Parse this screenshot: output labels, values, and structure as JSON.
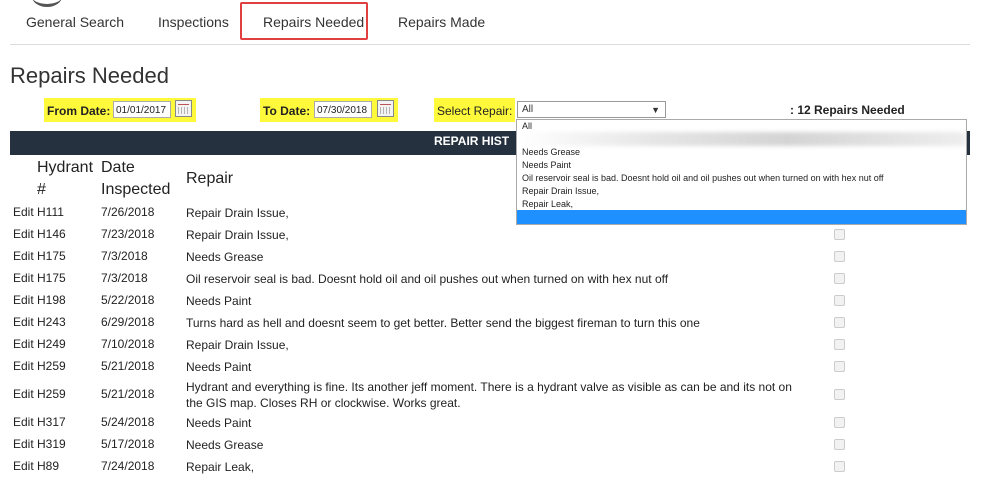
{
  "nav": {
    "tabs": [
      {
        "label": "General Search"
      },
      {
        "label": "Inspections"
      },
      {
        "label": "Repairs Needed"
      },
      {
        "label": "Repairs Made"
      }
    ]
  },
  "page": {
    "title": "Repairs Needed"
  },
  "filters": {
    "from_label": "From Date:",
    "from_value": "01/01/2017",
    "to_label": "To Date:",
    "to_value": "07/30/2018",
    "repair_label": "Select Repair:",
    "repair_value": "All",
    "count_text": ": 12 Repairs Needed",
    "highlight_color": "#fff93b"
  },
  "table": {
    "bar_title": "REPAIR HIST",
    "bar_color": "#26313f",
    "headers": {
      "hydrant_line1": "Hydrant",
      "hydrant_line2": "#",
      "date_line1": "Date",
      "date_line2": "Inspected",
      "repair": "Repair"
    },
    "rows": [
      {
        "edit": "Edit",
        "hydrant": "H111",
        "date": "7/26/2018",
        "repair": "Repair Drain Issue,"
      },
      {
        "edit": "Edit",
        "hydrant": "H146",
        "date": "7/23/2018",
        "repair": "Repair Drain Issue,"
      },
      {
        "edit": "Edit",
        "hydrant": "H175",
        "date": "7/3/2018",
        "repair": "Needs Grease"
      },
      {
        "edit": "Edit",
        "hydrant": "H175",
        "date": "7/3/2018",
        "repair": "Oil reservoir seal is bad. Doesnt hold oil and oil pushes out when turned on with hex nut off"
      },
      {
        "edit": "Edit",
        "hydrant": "H198",
        "date": "5/22/2018",
        "repair": "Needs Paint"
      },
      {
        "edit": "Edit",
        "hydrant": "H243",
        "date": "6/29/2018",
        "repair": "Turns hard as hell and doesnt seem to get better. Better send the biggest fireman to turn this one"
      },
      {
        "edit": "Edit",
        "hydrant": "H249",
        "date": "7/10/2018",
        "repair": "Repair Drain Issue,"
      },
      {
        "edit": "Edit",
        "hydrant": "H259",
        "date": "5/21/2018",
        "repair": "Needs Paint"
      },
      {
        "edit": "Edit",
        "hydrant": "H259",
        "date": "5/21/2018",
        "repair": "Hydrant and everything is fine. Its another jeff moment. There is a hydrant valve as visible as can be and its not on the GIS map. Closes RH or clockwise. Works great."
      },
      {
        "edit": "Edit",
        "hydrant": "H317",
        "date": "5/24/2018",
        "repair": "Needs Paint"
      },
      {
        "edit": "Edit",
        "hydrant": "H319",
        "date": "5/17/2018",
        "repair": "Needs Grease"
      },
      {
        "edit": "Edit",
        "hydrant": "H89",
        "date": "7/24/2018",
        "repair": "Repair Leak,"
      }
    ]
  },
  "dropdown": {
    "options": [
      "All",
      "Needs Grease",
      "Needs Paint",
      "Oil reservoir seal is bad. Doesnt hold oil and oil pushes out when turned on with hex nut off",
      "Repair Drain Issue,",
      "Repair Leak,"
    ],
    "highlight_color": "#1e90ff"
  }
}
